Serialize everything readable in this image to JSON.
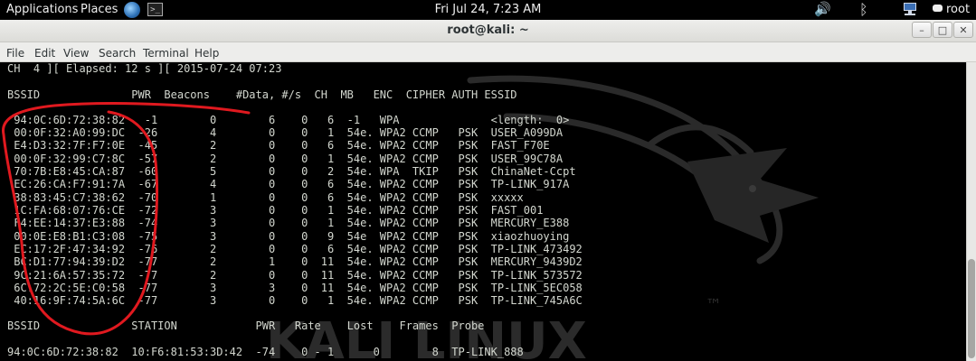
{
  "panel": {
    "applications": "Applications",
    "places": "Places",
    "terminal_glyph": ">_",
    "clock": "Fri Jul 24,  7:23 AM",
    "volume_glyph": "🔊",
    "bluetooth_glyph": "ᛒ",
    "user": "root"
  },
  "window": {
    "title": "root@kali: ~",
    "min_glyph": "–",
    "max_glyph": "□",
    "close_glyph": "✕"
  },
  "menubar": {
    "file": "File",
    "edit": "Edit",
    "view": "View",
    "search": "Search",
    "terminal": "Terminal",
    "help": "Help"
  },
  "terminal": {
    "status": "CH  4 ][ Elapsed: 12 s ][ 2015-07-24 07:23",
    "ap_header": "BSSID              PWR  Beacons    #Data, #/s  CH  MB   ENC  CIPHER AUTH ESSID",
    "ap_rows": [
      " 94:0C:6D:72:38:82   -1        0        6    0   6  -1   WPA              <length:  0>",
      " 00:0F:32:A0:99:DC  -26        4        0    0   1  54e. WPA2 CCMP   PSK  USER_A099DA",
      " E4:D3:32:7F:F7:0E  -45        2        0    0   6  54e. WPA2 CCMP   PSK  FAST_F70E",
      " 00:0F:32:99:C7:8C  -57        2        0    0   1  54e. WPA2 CCMP   PSK  USER_99C78A",
      " 70:7B:E8:45:CA:87  -60        5        0    0   2  54e. WPA  TKIP   PSK  ChinaNet-Ccpt",
      " EC:26:CA:F7:91:7A  -67        4        0    0   6  54e. WPA2 CCMP   PSK  TP-LINK_917A",
      " 38:83:45:C7:38:62  -70        1        0    0   6  54e. WPA2 CCMP   PSK  xxxxx",
      " 1C:FA:68:07:76:CE  -72        3        0    0   1  54e. WPA2 CCMP   PSK  FAST_001",
      " F4:EE:14:37:E3:88  -74        3        0    0   1  54e. WPA2 CCMP   PSK  MERCURY_E388",
      " 00:0E:E8:B1:C3:08  -75        3        0    0   9  54e  WPA2 CCMP   PSK  xiaozhuoying",
      " EC:17:2F:47:34:92  -76        2        0    0   6  54e. WPA2 CCMP   PSK  TP-LINK_473492",
      " BC:D1:77:94:39:D2  -77        2        1    0  11  54e. WPA2 CCMP   PSK  MERCURY_9439D2",
      " 9C:21:6A:57:35:72  -77        2        0    0  11  54e. WPA2 CCMP   PSK  TP-LINK_573572",
      " 6C:72:2C:5E:C0:58  -77        3        3    0  11  54e. WPA2 CCMP   PSK  TP-LINK_5EC058",
      " 40:16:9F:74:5A:6C  -77        3        0    0   1  54e. WPA2 CCMP   PSK  TP-LINK_745A6C"
    ],
    "sta_header": "BSSID              STATION            PWR   Rate    Lost    Frames  Probe",
    "sta_rows": [
      "94:0C:6D:72:38:82  10:F6:81:53:3D:42  -74    0 - 1      0        8  TP-LINK_888"
    ],
    "watermark": "KALI LINUX",
    "watermark_tm": "™"
  },
  "colors": {
    "terminal_bg": "#000000",
    "terminal_fg": "#d3d7cf",
    "annotation": "#e0191f"
  }
}
